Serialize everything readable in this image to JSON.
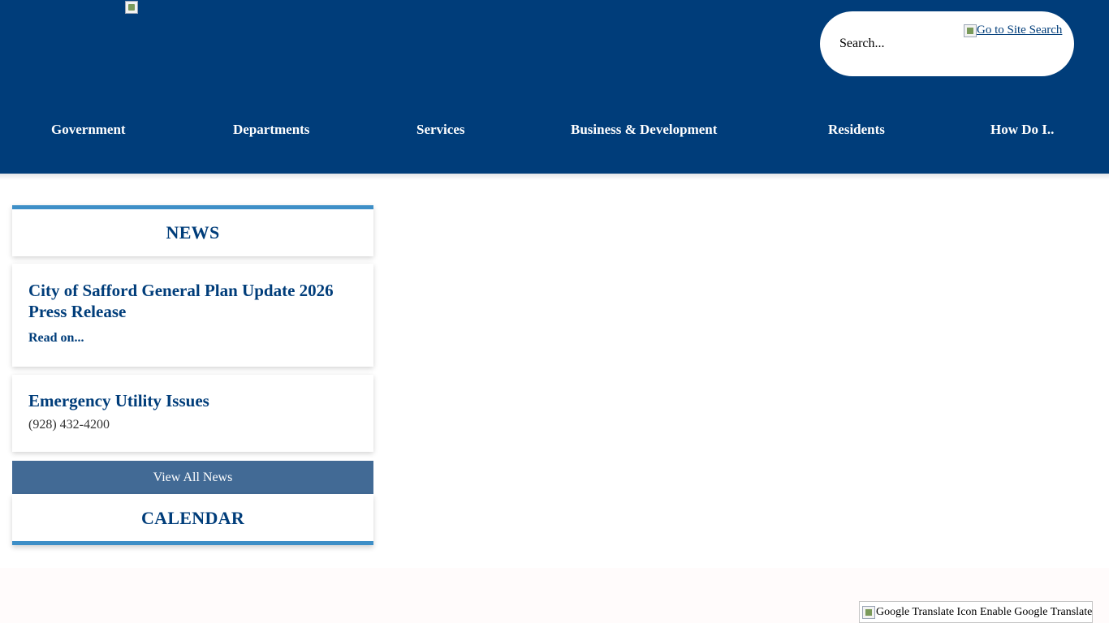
{
  "header": {
    "search": {
      "placeholder": "Search...",
      "site_search_link": "Go to Site Search"
    },
    "nav": [
      {
        "label": "Government"
      },
      {
        "label": "Departments"
      },
      {
        "label": "Services"
      },
      {
        "label": "Business & Development"
      },
      {
        "label": "Residents"
      },
      {
        "label": "How Do I.."
      }
    ]
  },
  "news": {
    "heading": "NEWS",
    "items": [
      {
        "title": "City of Safford General Plan Update 2026 Press Release",
        "link": "Read on..."
      },
      {
        "title": "Emergency Utility Issues",
        "detail": "(928) 432-4200"
      }
    ],
    "view_all": "View All News"
  },
  "calendar": {
    "heading": "CALENDAR"
  },
  "footer": {
    "translate_icon_alt": "Google Translate Icon",
    "translate_label": "Enable Google Translate"
  },
  "colors": {
    "header_bg": "#003d7a",
    "accent_blue": "#3e8fc7",
    "view_all_bg": "#426a95",
    "heading_text": "#003d7a"
  }
}
